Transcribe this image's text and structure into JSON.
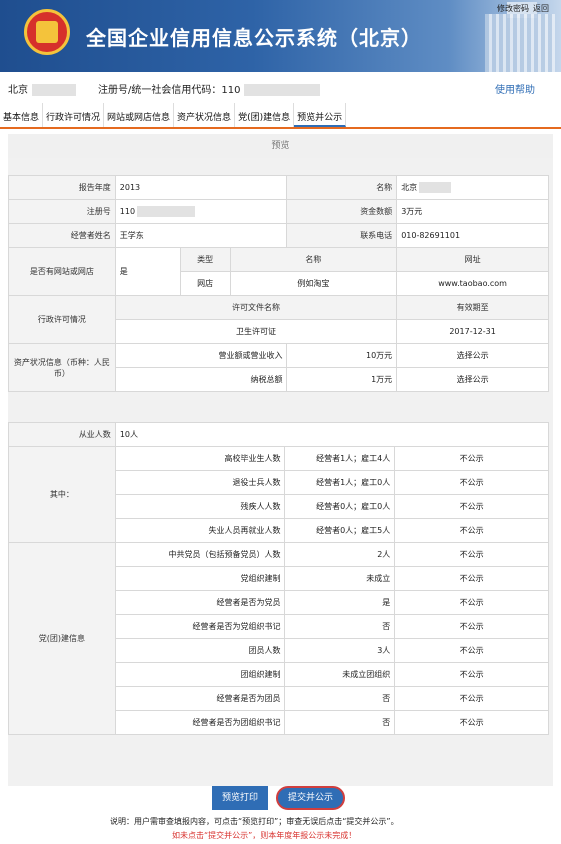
{
  "header": {
    "title": "全国企业信用信息公示系统（北京）",
    "link_change_pwd": "修改密码",
    "link_back": "返回"
  },
  "company": {
    "name_prefix": "北京",
    "reg_label": "注册号/统一社会信用代码：110",
    "help": "使用帮助"
  },
  "tabs": [
    "基本信息",
    "行政许可情况",
    "网站或网店信息",
    "资产状况信息",
    "党(团)建信息",
    "预览并公示"
  ],
  "preview_label": "预览",
  "basic": {
    "year_label": "报告年度",
    "year_value": "2013",
    "name_label": "名称",
    "name_value": "北京",
    "reg_label": "注册号",
    "reg_value": "110",
    "capital_label": "资金数额",
    "capital_value": "3万元",
    "operator_label": "经营者姓名",
    "operator_value": "王学东",
    "phone_label": "联系电话",
    "phone_value": "010-82691101"
  },
  "website": {
    "label": "是否有网站或网店",
    "value": "是",
    "headers": [
      "类型",
      "名称",
      "网址"
    ],
    "row": [
      "网店",
      "例如淘宝",
      "www.taobao.com"
    ]
  },
  "license": {
    "label": "行政许可情况",
    "headers": [
      "许可文件名称",
      "有效期至"
    ],
    "row": [
      "卫生许可证",
      "2017-12-31"
    ]
  },
  "assets": {
    "label": "资产状况信息（币种：人民币）",
    "rows": [
      {
        "name": "营业额或营业收入",
        "value": "10万元",
        "public": "选择公示"
      },
      {
        "name": "纳税总额",
        "value": "1万元",
        "public": "选择公示"
      }
    ]
  },
  "employees": {
    "label": "从业人数",
    "value": "10人"
  },
  "among": {
    "label": "其中：",
    "rows": [
      {
        "name": "高校毕业生人数",
        "value": "经营者1人；雇工4人",
        "public": "不公示"
      },
      {
        "name": "退役士兵人数",
        "value": "经营者1人；雇工0人",
        "public": "不公示"
      },
      {
        "name": "残疾人人数",
        "value": "经营者0人；雇工0人",
        "public": "不公示"
      },
      {
        "name": "失业人员再就业人数",
        "value": "经营者0人；雇工5人",
        "public": "不公示"
      }
    ]
  },
  "party": {
    "label": "党(团)建信息",
    "rows": [
      {
        "name": "中共党员（包括预备党员）人数",
        "value": "2人",
        "public": "不公示"
      },
      {
        "name": "党组织建制",
        "value": "未成立",
        "public": "不公示"
      },
      {
        "name": "经营者是否为党员",
        "value": "是",
        "public": "不公示"
      },
      {
        "name": "经营者是否为党组织书记",
        "value": "否",
        "public": "不公示"
      },
      {
        "name": "团员人数",
        "value": "3人",
        "public": "不公示"
      },
      {
        "name": "团组织建制",
        "value": "未成立团组织",
        "public": "不公示"
      },
      {
        "name": "经营者是否为团员",
        "value": "否",
        "public": "不公示"
      },
      {
        "name": "经营者是否为团组织书记",
        "value": "否",
        "public": "不公示"
      }
    ]
  },
  "actions": {
    "print": "预览打印",
    "submit": "提交并公示"
  },
  "notes": {
    "line1": "说明：用户需审查填报内容，可点击“预览打印”；审查无误后点击“提交并公示”。",
    "line2": "如未点击“提交并公示”，则本年度年报公示未完成！"
  }
}
